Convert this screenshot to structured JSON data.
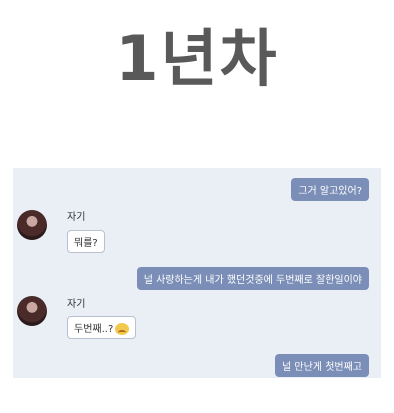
{
  "title": "1년차",
  "chat": {
    "messages": [
      {
        "from": "me",
        "text": "그거 알고있어?"
      },
      {
        "from": "other",
        "name": "자기",
        "text": "뭐를?"
      },
      {
        "from": "me",
        "text": "널 사랑하는게 내가 했던것중에 두번째로 잘한일이야"
      },
      {
        "from": "other",
        "name": "자기",
        "text": "두번째..?"
      },
      {
        "from": "me",
        "text": "널 만난게 첫번째고"
      }
    ]
  },
  "icons": {
    "avatar": "profile-photo",
    "reaction": "crying-laughing-emoji"
  },
  "colors": {
    "outgoing_bubble": "#7b8eb7",
    "chat_background": "#eaeef5",
    "title": "#595959"
  }
}
